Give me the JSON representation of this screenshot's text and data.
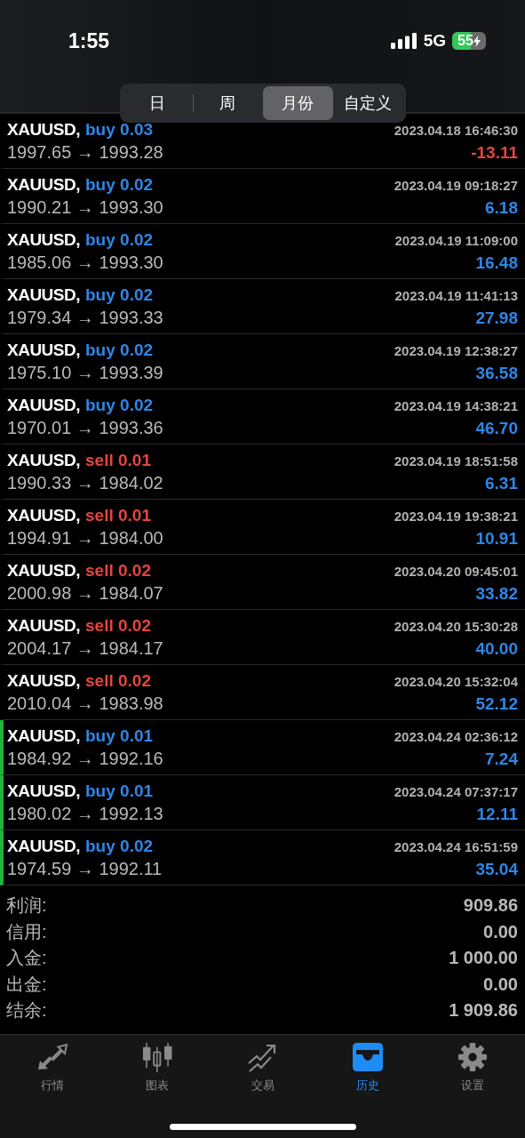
{
  "status_bar": {
    "time": "1:55",
    "network": "5G",
    "battery": "55"
  },
  "period_tabs": [
    {
      "label": "日",
      "selected": false
    },
    {
      "label": "周",
      "selected": false
    },
    {
      "label": "月份",
      "selected": true
    },
    {
      "label": "自定义",
      "selected": false
    }
  ],
  "deals": [
    {
      "symbol": "XAUUSD,",
      "order": "buy 0.03",
      "kind": "buy",
      "prices": "1997.65 → 1993.28",
      "time": "2023.04.18 16:46:30",
      "profit": "-13.11",
      "loss": true,
      "marked": false
    },
    {
      "symbol": "XAUUSD,",
      "order": "buy 0.02",
      "kind": "buy",
      "prices": "1990.21 → 1993.30",
      "time": "2023.04.19 09:18:27",
      "profit": "6.18",
      "loss": false,
      "marked": false
    },
    {
      "symbol": "XAUUSD,",
      "order": "buy 0.02",
      "kind": "buy",
      "prices": "1985.06 → 1993.30",
      "time": "2023.04.19 11:09:00",
      "profit": "16.48",
      "loss": false,
      "marked": false
    },
    {
      "symbol": "XAUUSD,",
      "order": "buy 0.02",
      "kind": "buy",
      "prices": "1979.34 → 1993.33",
      "time": "2023.04.19 11:41:13",
      "profit": "27.98",
      "loss": false,
      "marked": false
    },
    {
      "symbol": "XAUUSD,",
      "order": "buy 0.02",
      "kind": "buy",
      "prices": "1975.10 → 1993.39",
      "time": "2023.04.19 12:38:27",
      "profit": "36.58",
      "loss": false,
      "marked": false
    },
    {
      "symbol": "XAUUSD,",
      "order": "buy 0.02",
      "kind": "buy",
      "prices": "1970.01 → 1993.36",
      "time": "2023.04.19 14:38:21",
      "profit": "46.70",
      "loss": false,
      "marked": false
    },
    {
      "symbol": "XAUUSD,",
      "order": "sell 0.01",
      "kind": "sell",
      "prices": "1990.33 → 1984.02",
      "time": "2023.04.19 18:51:58",
      "profit": "6.31",
      "loss": false,
      "marked": false
    },
    {
      "symbol": "XAUUSD,",
      "order": "sell 0.01",
      "kind": "sell",
      "prices": "1994.91 → 1984.00",
      "time": "2023.04.19 19:38:21",
      "profit": "10.91",
      "loss": false,
      "marked": false
    },
    {
      "symbol": "XAUUSD,",
      "order": "sell 0.02",
      "kind": "sell",
      "prices": "2000.98 → 1984.07",
      "time": "2023.04.20 09:45:01",
      "profit": "33.82",
      "loss": false,
      "marked": false
    },
    {
      "symbol": "XAUUSD,",
      "order": "sell 0.02",
      "kind": "sell",
      "prices": "2004.17 → 1984.17",
      "time": "2023.04.20 15:30:28",
      "profit": "40.00",
      "loss": false,
      "marked": false
    },
    {
      "symbol": "XAUUSD,",
      "order": "sell 0.02",
      "kind": "sell",
      "prices": "2010.04 → 1983.98",
      "time": "2023.04.20 15:32:04",
      "profit": "52.12",
      "loss": false,
      "marked": false
    },
    {
      "symbol": "XAUUSD,",
      "order": "buy 0.01",
      "kind": "buy",
      "prices": "1984.92 → 1992.16",
      "time": "2023.04.24 02:36:12",
      "profit": "7.24",
      "loss": false,
      "marked": true
    },
    {
      "symbol": "XAUUSD,",
      "order": "buy 0.01",
      "kind": "buy",
      "prices": "1980.02 → 1992.13",
      "time": "2023.04.24 07:37:17",
      "profit": "12.11",
      "loss": false,
      "marked": true
    },
    {
      "symbol": "XAUUSD,",
      "order": "buy 0.02",
      "kind": "buy",
      "prices": "1974.59 → 1992.11",
      "time": "2023.04.24 16:51:59",
      "profit": "35.04",
      "loss": false,
      "marked": true
    }
  ],
  "summary": [
    {
      "label": "利润:",
      "value": "909.86"
    },
    {
      "label": "信用:",
      "value": "0.00"
    },
    {
      "label": "入金:",
      "value": "1 000.00"
    },
    {
      "label": "出金:",
      "value": "0.00"
    },
    {
      "label": "结余:",
      "value": "1 909.86"
    }
  ],
  "bottom_tabs": [
    {
      "label": "行情",
      "selected": false
    },
    {
      "label": "图表",
      "selected": false
    },
    {
      "label": "交易",
      "selected": false
    },
    {
      "label": "历史",
      "selected": true
    },
    {
      "label": "设置",
      "selected": false
    }
  ]
}
